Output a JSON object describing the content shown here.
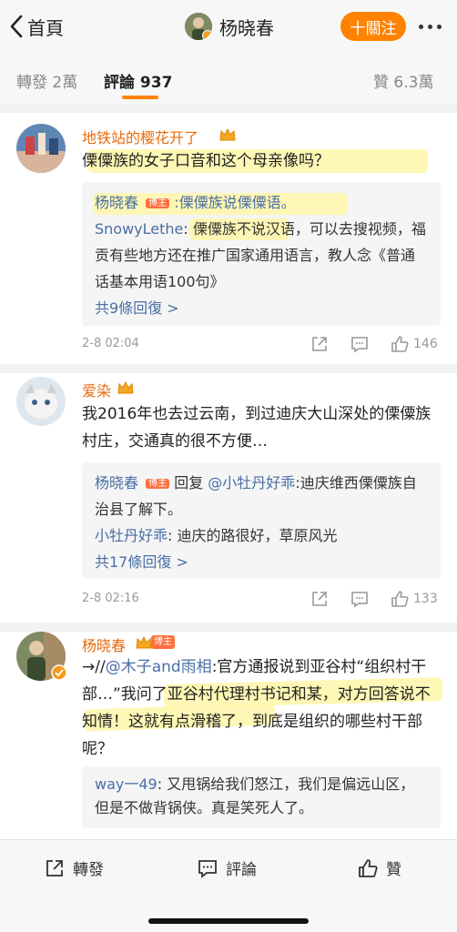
{
  "header": {
    "back_label": "首頁",
    "user_name": "杨晓春",
    "follow_label": "十關注"
  },
  "tabs": {
    "repost": "轉發 2萬",
    "comments": "評論 937",
    "likes": "贊 6.3萬"
  },
  "comments": [
    {
      "user": "地铁站的樱花开了",
      "text": "傈僳族的女子口音和这个母亲像吗？",
      "replies": [
        {
          "user": "杨晓春",
          "badge": "博主",
          "text": ":傈僳族说傈僳语。"
        },
        {
          "user": "SnowyLethe",
          "text": ": 傈僳族不说汉语，可以去搜视频，福贡有些地方还在推广国家通用语言，教人念《普通话基本用语100句》"
        }
      ],
      "more": "共9條回復 >",
      "time": "2-8 02:04",
      "likes": "146"
    },
    {
      "user": "爱染",
      "text": "我2016年也去过云南，到过迪庆大山深处的傈僳族村庄，交通真的很不方便…",
      "replies": [
        {
          "user": "杨晓春",
          "badge": "博主",
          "prefix": " 回复 ",
          "mention": "@小牡丹好乖",
          "text": ":迪庆维西傈僳族自治县了解下。"
        },
        {
          "user": "小牡丹好乖",
          "text": ": 迪庆的路很好，草原风光"
        }
      ],
      "more": "共17條回復 >",
      "time": "2-8 02:16",
      "likes": "133"
    },
    {
      "user": "杨晓春",
      "badge": "博主",
      "prefix": "→//",
      "mention": "@木子and雨相",
      "text": ":官方通报说到亚谷村“组织村干部…”我问了亚谷村代理村书记和某，对方回答说不知情！这就有点滑稽了，到底是组织的哪些村干部呢？",
      "replies": [
        {
          "user": "way一49",
          "text": ": 又甩锅给我们怒江，我们是偏远山区，但是不做背锅侠。真是笑死人了。"
        }
      ]
    }
  ],
  "bottom_bar": {
    "repost": "轉發",
    "comment": "評論",
    "like": "贊"
  },
  "colors": {
    "accent": "#ff8200",
    "username": "#e86b0c",
    "link": "#4a6fa5",
    "highlight": "#fff6a8"
  }
}
